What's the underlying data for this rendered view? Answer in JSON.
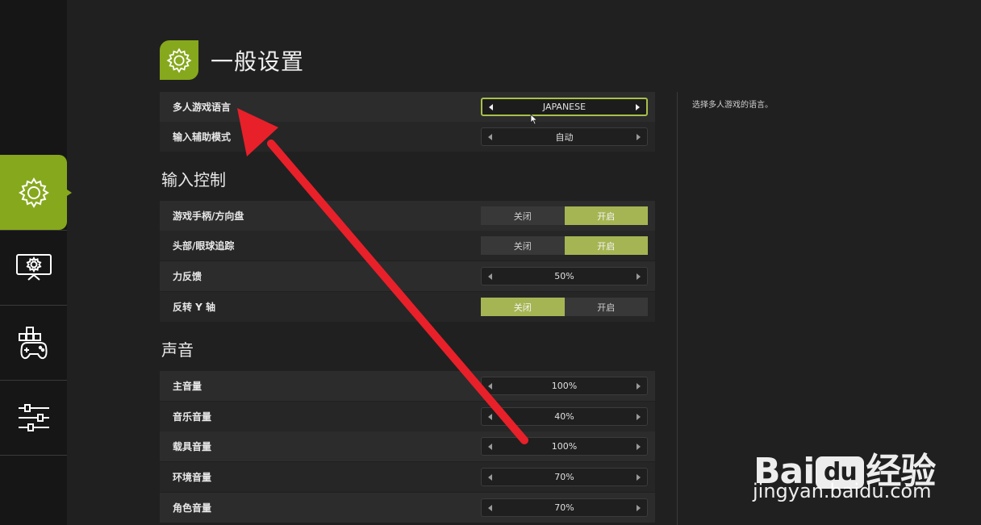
{
  "header": {
    "title": "一般设置",
    "icon": "gear-icon"
  },
  "sidebar": {
    "items": [
      {
        "icon": "gear-icon",
        "active": true
      },
      {
        "icon": "monitor-gear-icon",
        "active": false
      },
      {
        "icon": "gamepad-icon",
        "active": false
      },
      {
        "icon": "sliders-icon",
        "active": false
      }
    ]
  },
  "settings": {
    "multiplayer_language": {
      "label": "多人游戏语言",
      "value": "JAPANESE"
    },
    "input_assist": {
      "label": "输入辅助模式",
      "value": "自动"
    },
    "input_section": "输入控制",
    "gamepad": {
      "label": "游戏手柄/方向盘",
      "off": "关闭",
      "on": "开启",
      "selected": "on"
    },
    "head_tracking": {
      "label": "头部/眼球追踪",
      "off": "关闭",
      "on": "开启",
      "selected": "on"
    },
    "force_feedback": {
      "label": "力反馈",
      "value": "50%"
    },
    "invert_y": {
      "label": "反转 Y 轴",
      "off": "关闭",
      "on": "开启",
      "selected": "off"
    },
    "sound_section": "声音",
    "master_volume": {
      "label": "主音量",
      "value": "100%"
    },
    "music_volume": {
      "label": "音乐音量",
      "value": "40%"
    },
    "vehicle_volume": {
      "label": "载具音量",
      "value": "100%"
    },
    "ambient_volume": {
      "label": "环境音量",
      "value": "70%"
    },
    "character_volume": {
      "label": "角色音量",
      "value": "70%"
    }
  },
  "description": "选择多人游戏的语言。",
  "watermark": {
    "logo_left": "Bai",
    "logo_mid": "du",
    "logo_right": "经验",
    "url": "jingyan.baidu.com"
  },
  "colors": {
    "accent": "#86a81c",
    "toggle_on": "#a6b553",
    "annotation": "#e8202a"
  }
}
